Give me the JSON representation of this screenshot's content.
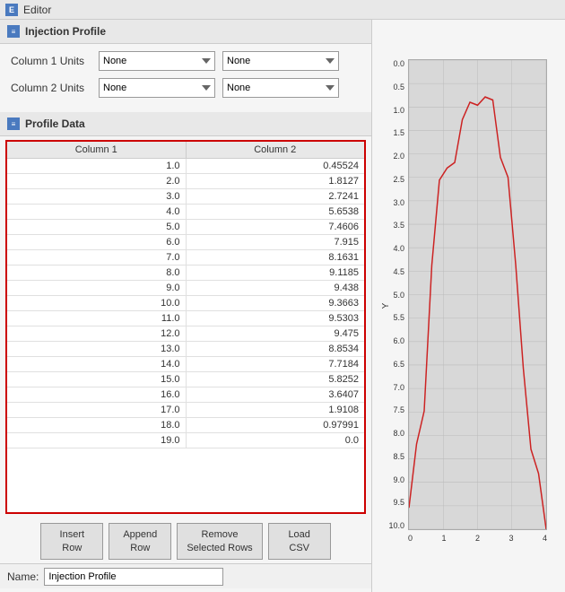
{
  "titleBar": {
    "icon": "E",
    "label": "Editor"
  },
  "injectionProfile": {
    "sectionIcon": "≡",
    "sectionLabel": "Injection Profile",
    "column1Units": {
      "label": "Column 1 Units",
      "select1Value": "None",
      "select2Value": "None"
    },
    "column2Units": {
      "label": "Column 2 Units",
      "select1Value": "None",
      "select2Value": "None"
    }
  },
  "profileData": {
    "sectionIcon": "≡",
    "sectionLabel": "Profile Data",
    "columns": [
      "Column 1",
      "Column 2"
    ],
    "rows": [
      [
        "1.0",
        "0.45524"
      ],
      [
        "2.0",
        "1.8127"
      ],
      [
        "3.0",
        "2.7241"
      ],
      [
        "4.0",
        "5.6538"
      ],
      [
        "5.0",
        "7.4606"
      ],
      [
        "6.0",
        "7.915"
      ],
      [
        "7.0",
        "8.1631"
      ],
      [
        "8.0",
        "9.1185"
      ],
      [
        "9.0",
        "9.438"
      ],
      [
        "10.0",
        "9.3663"
      ],
      [
        "11.0",
        "9.5303"
      ],
      [
        "12.0",
        "9.475"
      ],
      [
        "13.0",
        "8.8534"
      ],
      [
        "14.0",
        "7.7184"
      ],
      [
        "15.0",
        "5.8252"
      ],
      [
        "16.0",
        "3.6407"
      ],
      [
        "17.0",
        "1.9108"
      ],
      [
        "18.0",
        "0.97991"
      ],
      [
        "19.0",
        "0.0"
      ]
    ]
  },
  "buttons": {
    "insertRow": "Insert\nRow",
    "appendRow": "Append\nRow",
    "removeSelectedRows": "Remove\nSelected Rows",
    "loadCSV": "Load\nCSV"
  },
  "nameBar": {
    "label": "Name:",
    "value": "Injection Profile"
  },
  "chart": {
    "yAxisTitle": "Y",
    "yLabels": [
      "10.0",
      "9.5",
      "9.0",
      "8.5",
      "8.0",
      "7.5",
      "7.0",
      "6.5",
      "6.0",
      "5.5",
      "5.0",
      "4.5",
      "4.0",
      "3.5",
      "3.0",
      "2.5",
      "2.0",
      "1.5",
      "1.0",
      "0.5",
      "0.0"
    ],
    "xLabels": [
      "0",
      "1",
      "2",
      "3",
      "4"
    ]
  }
}
